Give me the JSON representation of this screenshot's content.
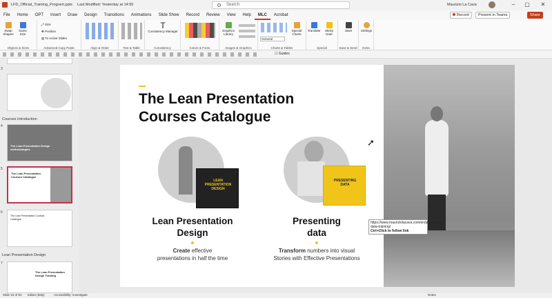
{
  "titlebar": {
    "filename": "LFD_Official_Training_Program.pptx",
    "last_modified": "Last Modified: Yesterday at 14:55",
    "search_placeholder": "Search",
    "user": "Maurizio La Cava"
  },
  "menu": {
    "items": [
      "File",
      "Home",
      "OPT",
      "Insert",
      "Draw",
      "Design",
      "Transitions",
      "Animations",
      "Slide Show",
      "Record",
      "Review",
      "View",
      "Help",
      "MLC",
      "Acrobat"
    ],
    "active": "MLC",
    "record_label": "Record",
    "present_label": "Present in Teams",
    "share_label": "Share"
  },
  "ribbon": {
    "groups": [
      {
        "label": "Objects & Sizes",
        "buttons": [
          "Swap Shapes",
          "Same Size"
        ]
      },
      {
        "label": "Advanced Copy Paste",
        "buttons": [
          "Size",
          "Position",
          "To Active Slides"
        ]
      },
      {
        "label": "Align & Order",
        "buttons": []
      },
      {
        "label": "Text & Table",
        "buttons": []
      },
      {
        "label": "Consistency",
        "buttons": [
          "Consistency Manager"
        ]
      },
      {
        "label": "Colors & Fonts",
        "buttons": []
      },
      {
        "label": "Images & Graphics",
        "buttons": [
          "Graphics Library"
        ]
      },
      {
        "label": "Charts & Tables",
        "buttons": [
          "Special Charts"
        ],
        "dropdown": "General"
      },
      {
        "label": "Special",
        "buttons": [
          "Translate",
          "Sticky Note"
        ]
      },
      {
        "label": "Save & Send",
        "buttons": [
          "Save"
        ]
      },
      {
        "label": "Extra",
        "buttons": [
          "Settings"
        ]
      }
    ],
    "guides_label": "Guides"
  },
  "thumbnails": {
    "sections": [
      "Courses Introduction",
      "Lean Presentation Design"
    ],
    "slides": [
      {
        "num": "3",
        "text": "",
        "selected": false
      },
      {
        "num": "4",
        "text": "The Lean Presentation Design methodologies",
        "selected": false
      },
      {
        "num": "5",
        "text": "The Lean Presentation Courses Catalogue",
        "selected": true
      },
      {
        "num": "6",
        "text": "The Lean Presentation Courses Catalogue",
        "selected": false
      },
      {
        "num": "7",
        "text": "The Lean Presentation Design Training",
        "selected": false
      }
    ]
  },
  "slide": {
    "title_line1": "The Lean Presentation",
    "title_line2": "Courses Catalogue",
    "courses": [
      {
        "name_line1": "Lean Presentation",
        "name_line2": "Design",
        "desc_bold": "Create",
        "desc_rest": "effective",
        "desc_line2": "presentations in half the time",
        "book_line1": "LEAN",
        "book_line2": "PRESENTATION",
        "book_line3": "DESIGN"
      },
      {
        "name_line1": "Presenting",
        "name_line2": "data",
        "desc_bold": "Transform",
        "desc_rest": "numbers into visual",
        "desc_line2": "Stories with Effective Presentations",
        "book_line1": "PRESENTING",
        "book_line2": "DATA",
        "book_line3": ""
      }
    ],
    "tooltip_url": "https://www.mauriziolacava.com/en/presenting-data-training/",
    "tooltip_hint": "Ctrl+Click to follow link"
  },
  "status": {
    "slide_info": "Slide 15 of 54",
    "language": "Italian (Italy)",
    "accessibility": "Accessibility: Investigate",
    "notes": "Notes"
  },
  "colors": {
    "accent": "#c43e1c",
    "yellow": "#f0c419",
    "selected_thumb": "#c4314b"
  }
}
